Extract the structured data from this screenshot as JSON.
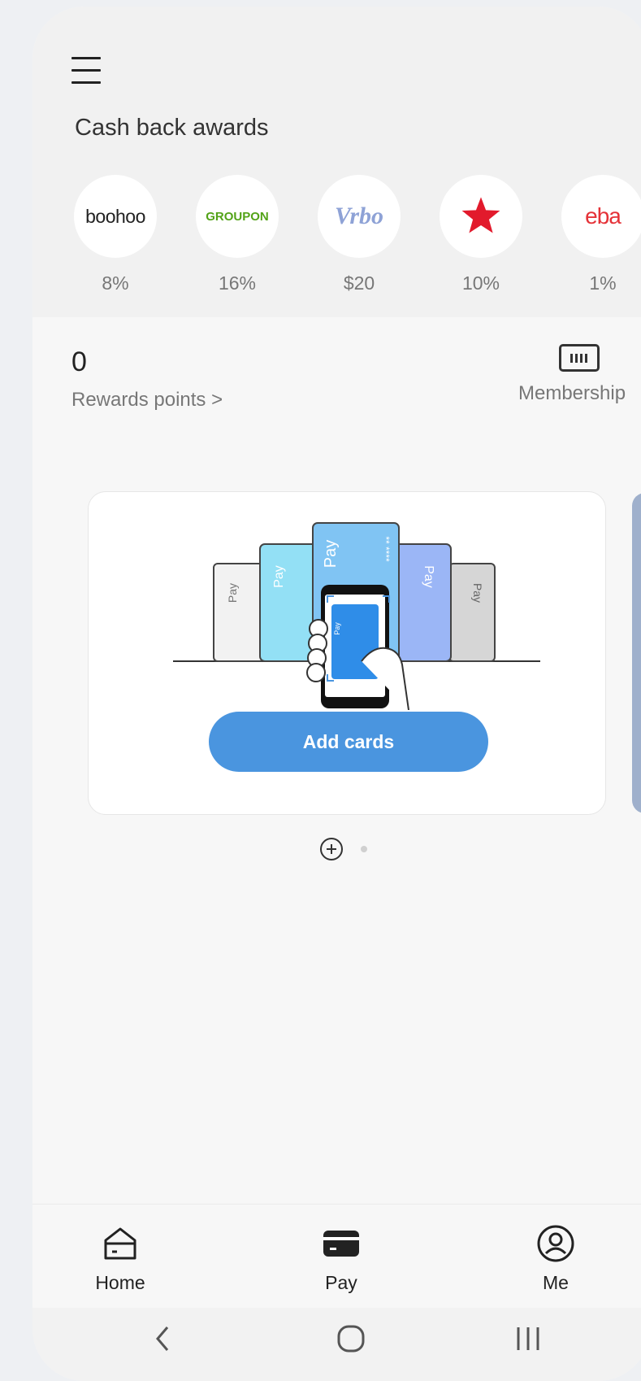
{
  "header": {
    "menu_icon": "hamburger-menu-icon",
    "title": "Cash back awards"
  },
  "merchants": [
    {
      "name": "boohoo",
      "logo_text": "boohoo",
      "reward": "8%"
    },
    {
      "name": "groupon",
      "logo_text": "GROUPON",
      "reward": "16%"
    },
    {
      "name": "vrbo",
      "logo_text": "Vrbo",
      "reward": "$20"
    },
    {
      "name": "macys",
      "logo_icon": "red-star-icon",
      "reward": "10%"
    },
    {
      "name": "ebay",
      "logo_text": "eba",
      "reward": "1%"
    }
  ],
  "rewards": {
    "value": "0",
    "label": "Rewards points >"
  },
  "membership": {
    "icon": "barcode-icon",
    "label": "Membership"
  },
  "card": {
    "illustration_label": "Pay",
    "masked_number": "** ****",
    "add_button": "Add cards"
  },
  "bottom_nav": [
    {
      "label": "Home",
      "icon": "home-wallet-icon"
    },
    {
      "label": "Pay",
      "icon": "card-icon"
    },
    {
      "label": "Me",
      "icon": "person-circle-icon"
    }
  ],
  "colors": {
    "accent": "#4a95df",
    "groupon": "#53a318",
    "macys": "#e21a2c",
    "vrbo": "#8ea2d6"
  }
}
